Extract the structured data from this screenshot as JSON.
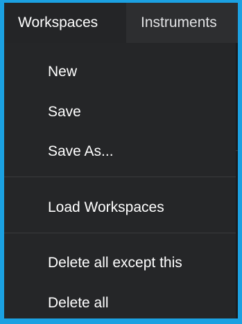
{
  "menubar": {
    "tabs": [
      {
        "label": "Workspaces"
      },
      {
        "label": "Instruments"
      }
    ]
  },
  "dropdown": {
    "items": [
      {
        "label": "New"
      },
      {
        "label": "Save"
      },
      {
        "label": "Save As..."
      },
      {
        "label": "Load Workspaces"
      },
      {
        "label": "Delete all except this"
      },
      {
        "label": "Delete all"
      }
    ]
  },
  "colors": {
    "accent_border": "#1ba1e2",
    "menu_background": "#252628",
    "text": "#ffffff"
  }
}
